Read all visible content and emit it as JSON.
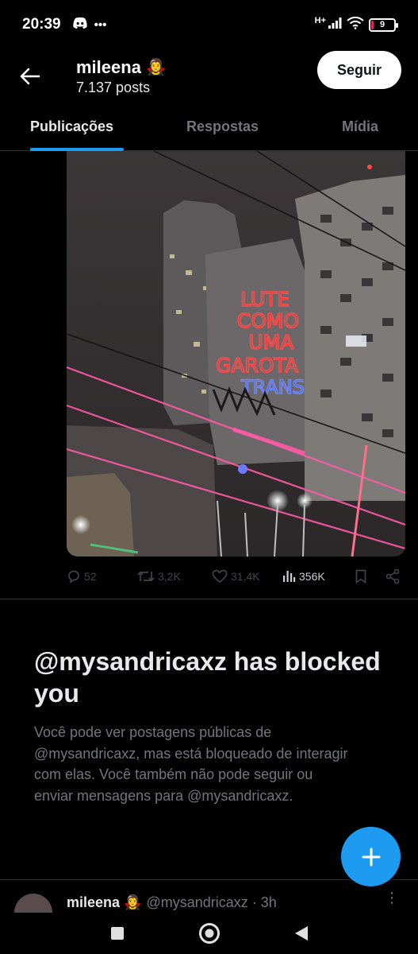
{
  "status_bar": {
    "time": "20:39",
    "left_icons": [
      "discord-icon",
      "more-dots-icon"
    ],
    "network": "H+",
    "battery": "9",
    "battery_level_percent": 9
  },
  "header": {
    "name": "mileena",
    "name_emoji": "🧛‍♀️",
    "post_count": "7.137 posts",
    "follow_label": "Seguir"
  },
  "tabs": [
    {
      "label": "Publicações",
      "active": true
    },
    {
      "label": "Respostas",
      "active": false
    },
    {
      "label": "Mídia",
      "active": false
    }
  ],
  "media": {
    "projection_lines": [
      "LUTE",
      "COMO",
      "UMA",
      "GAROTA",
      "TRANS"
    ],
    "projection_color": "#ff4a4a",
    "projection_accent": "#5a7bff"
  },
  "actions": {
    "replies": "52",
    "reposts": "3,2K",
    "likes": "31,4K",
    "views": "356K"
  },
  "blocked": {
    "title": "@mysandricaxz has blocked you",
    "description": "Você pode ver postagens públicas de @mysandricaxz, mas está bloqueado de interagir com elas. Você também não pode seguir ou enviar mensagens para @mysandricaxz."
  },
  "next_post": {
    "name": "mileena 🧛‍♀️",
    "handle": "@mysandricaxz · 3h"
  },
  "colors": {
    "accent": "#1d9bf0",
    "background": "#000000",
    "muted_text": "#71767b"
  }
}
